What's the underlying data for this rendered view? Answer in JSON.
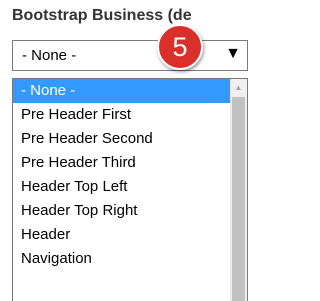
{
  "heading": "Bootstrap Business (de",
  "select": {
    "value": "- None -",
    "arrow": "▼"
  },
  "badge": {
    "number": "5",
    "color": "#d9302b"
  },
  "dropdown": {
    "options": [
      "- None -",
      "Pre Header First",
      "Pre Header Second",
      "Pre Header Third",
      "Header Top Left",
      "Header Top Right",
      "Header",
      "Navigation"
    ],
    "selected_index": 0,
    "highlight_color": "#3399ff"
  },
  "scrollbar": {
    "up_arrow": "▲"
  }
}
